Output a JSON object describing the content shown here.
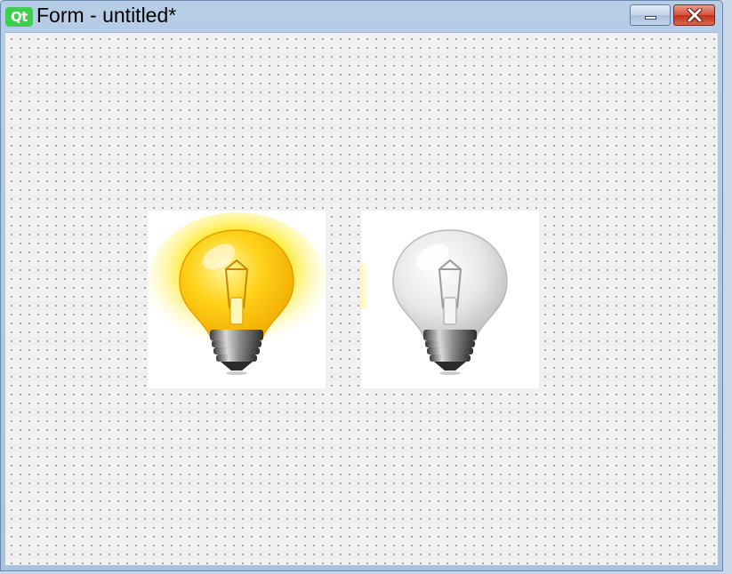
{
  "window": {
    "app_logo": "Qt",
    "title": "Form - untitled*"
  },
  "controls": {
    "minimize_icon": "minimize-icon",
    "close_icon": "close-icon"
  },
  "form": {
    "grid": "dotted",
    "widgets": [
      {
        "type": "label-image",
        "icon": "lightbulb-on-icon",
        "state": "on"
      },
      {
        "type": "label-image",
        "icon": "lightbulb-off-icon",
        "state": "off"
      }
    ]
  },
  "colors": {
    "qt_green": "#41cd52",
    "bulb_on_glow": "#ffd000",
    "close_button": "#c8432a",
    "canvas_bg": "#f0f0f0"
  }
}
